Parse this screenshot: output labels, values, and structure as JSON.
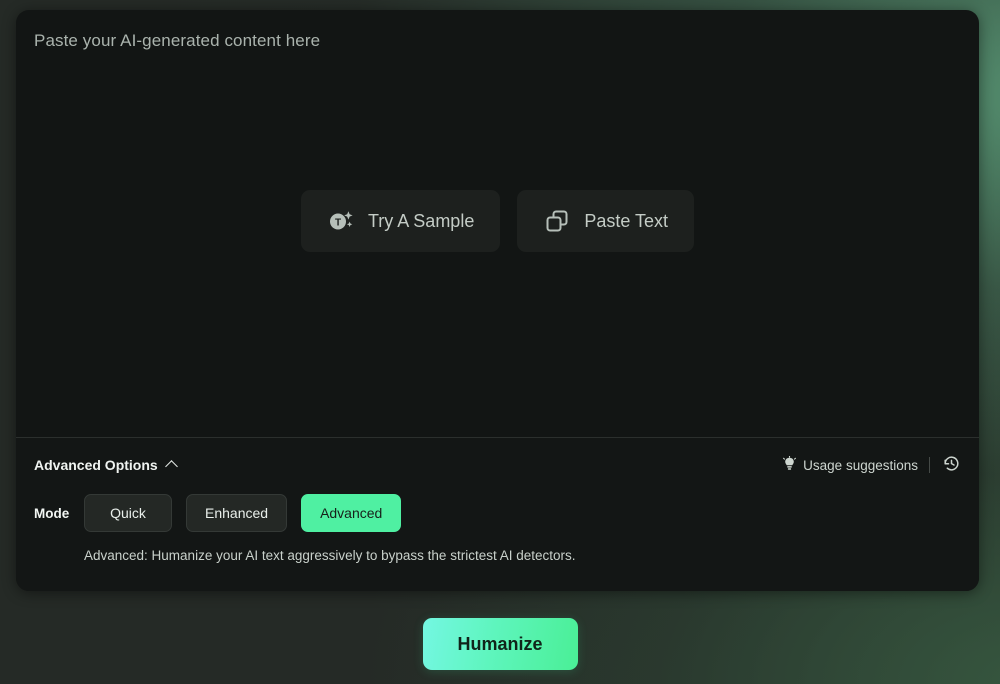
{
  "theme": {
    "card_bg": "#121514",
    "page_bg": "#252a26",
    "accent_green": "#4ff0a2",
    "accent_aqua": "#74f7e2",
    "text_primary": "#f0f4f1",
    "text_muted": "#aab3ad"
  },
  "editor": {
    "placeholder": "Paste your AI-generated content here",
    "quick_actions": [
      {
        "label": "Try A Sample",
        "icon": "sample-sparkle-icon"
      },
      {
        "label": "Paste Text",
        "icon": "copy-paste-icon"
      }
    ]
  },
  "advanced_options": {
    "toggle_label": "Advanced Options",
    "toggle_state": "expanded",
    "chevron_icon": "chevron-up-icon",
    "usage_suggestions": {
      "label": "Usage suggestions",
      "icon": "lightbulb-icon"
    },
    "history": {
      "icon": "history-clock-icon"
    },
    "mode": {
      "label": "Mode",
      "options": [
        {
          "label": "Quick",
          "selected": false
        },
        {
          "label": "Enhanced",
          "selected": false
        },
        {
          "label": "Advanced",
          "selected": true
        }
      ],
      "description": "Advanced: Humanize your AI text aggressively to bypass the strictest AI detectors."
    }
  },
  "submit": {
    "label": "Humanize"
  }
}
